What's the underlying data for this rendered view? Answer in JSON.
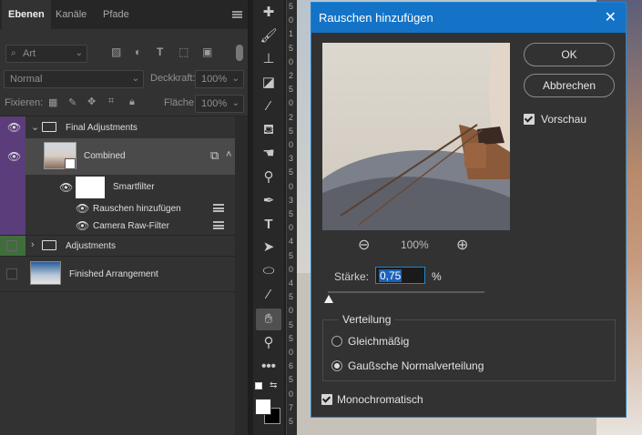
{
  "layers_panel": {
    "tabs": [
      "Ebenen",
      "Kanäle",
      "Pfade"
    ],
    "filter_kind": "Art",
    "blend_mode": "Normal",
    "opacity_label": "Deckkraft:",
    "opacity_value": "100%",
    "lock_label": "Fixieren:",
    "fill_label": "Fläche:",
    "fill_value": "100%",
    "layers": [
      {
        "name": "Final Adjustments",
        "type": "group",
        "color": "#5a3d7a"
      },
      {
        "name": "Combined",
        "type": "smart-object",
        "color": "#5a3d7a"
      },
      {
        "name": "Smartfilter",
        "type": "filter-mask"
      },
      {
        "name": "Rauschen hinzufügen",
        "type": "filter"
      },
      {
        "name": "Camera Raw-Filter",
        "type": "filter"
      },
      {
        "name": "Adjustments",
        "type": "group",
        "color": "#3f6e3a"
      },
      {
        "name": "Finished Arrangement",
        "type": "layer"
      }
    ]
  },
  "toolbar": {
    "tools": [
      "healing-brush-icon",
      "brush-icon",
      "clone-stamp-icon",
      "eraser-icon",
      "eyedropper-icon",
      "paint-bucket-icon",
      "smudge-icon",
      "dodge-icon",
      "pen-icon",
      "type-icon",
      "path-selection-icon",
      "ellipse-icon",
      "color-sampler-icon",
      "hand-icon",
      "zoom-icon",
      "more-tools-icon"
    ],
    "active_tool": "hand-icon"
  },
  "ruler": {
    "numbers": [
      "5",
      "0",
      "1",
      "5",
      "0",
      "2",
      "5",
      "0",
      "2",
      "5",
      "0",
      "3",
      "5",
      "0",
      "3",
      "5",
      "0",
      "4",
      "5",
      "0",
      "4",
      "5",
      "0",
      "5",
      "5",
      "0",
      "6",
      "5",
      "0",
      "7",
      "5"
    ]
  },
  "dialog": {
    "title": "Rauschen hinzufügen",
    "ok": "OK",
    "cancel": "Abbrechen",
    "preview_label": "Vorschau",
    "preview_checked": true,
    "zoom": "100%",
    "amount_label": "Stärke:",
    "amount_value": "0,75",
    "amount_unit": "%",
    "distribution_label": "Verteilung",
    "uniform_label": "Gleichmäßig",
    "gaussian_label": "Gaußsche Normalverteilung",
    "selected_distribution": "gaussian",
    "mono_label": "Monochromatisch",
    "mono_checked": true,
    "accent": "#1473c6"
  }
}
